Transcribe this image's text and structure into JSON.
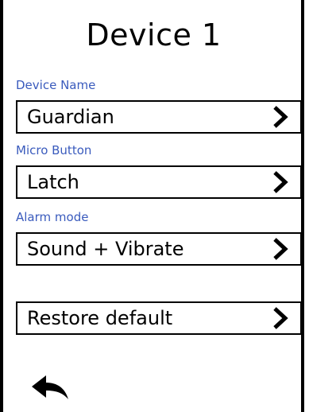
{
  "screen": {
    "title": "Device 1"
  },
  "settings": [
    {
      "section_label": "Device Name",
      "value": "Guardian"
    },
    {
      "section_label": "Micro Button",
      "value": "Latch"
    },
    {
      "section_label": "Alarm mode",
      "value": "Sound + Vibrate"
    }
  ],
  "restore": {
    "label": "Restore default"
  },
  "icons": {
    "row_arrow": "chevron-right-icon",
    "back": "back-arrow-icon"
  },
  "colors": {
    "section_label": "#3a5bbd",
    "border": "#000000",
    "background": "#ffffff"
  }
}
